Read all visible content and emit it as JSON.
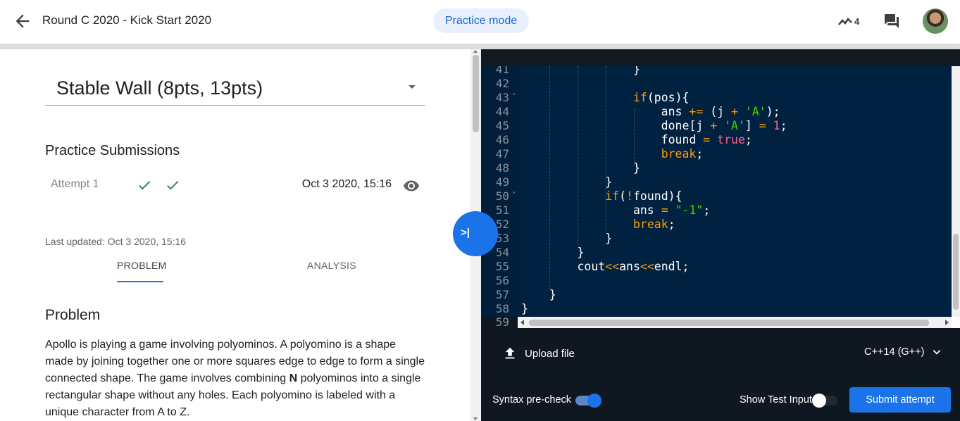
{
  "header": {
    "title": "Round C 2020 - Kick Start 2020",
    "mode_chip": "Practice mode",
    "trend_count": "4"
  },
  "problem_select": {
    "value": "Stable Wall (8pts, 13pts)"
  },
  "submissions": {
    "title": "Practice Submissions",
    "attempts": [
      {
        "label": "Attempt 1",
        "date": "Oct 3 2020, 15:16"
      }
    ]
  },
  "last_updated": "Last updated: Oct 3 2020, 15:16",
  "tabs": {
    "problem": "PROBLEM",
    "analysis": "ANALYSIS"
  },
  "problem": {
    "heading": "Problem",
    "text_1": "Apollo is playing a game involving polyominos. A polyomino is a shape made by joining together one or more squares edge to edge to form a single connected shape. The game involves combining ",
    "text_bold": "N",
    "text_2": " polyominos into a single rectangular shape without any holes. Each polyomino is labeled with a unique character from A to Z."
  },
  "collapse_button": ">|",
  "editor": {
    "line_numbers": [
      "41",
      "42",
      "43",
      "44",
      "45",
      "46",
      "47",
      "48",
      "49",
      "50",
      "51",
      "52",
      "53",
      "54",
      "55",
      "56",
      "57",
      "58",
      "59"
    ]
  },
  "bottom_bar": {
    "upload_label": "Upload file",
    "language": "C++14 (G++)",
    "syntax_label": "Syntax pre-check",
    "show_test_label": "Show Test Input",
    "submit_label": "Submit attempt"
  }
}
